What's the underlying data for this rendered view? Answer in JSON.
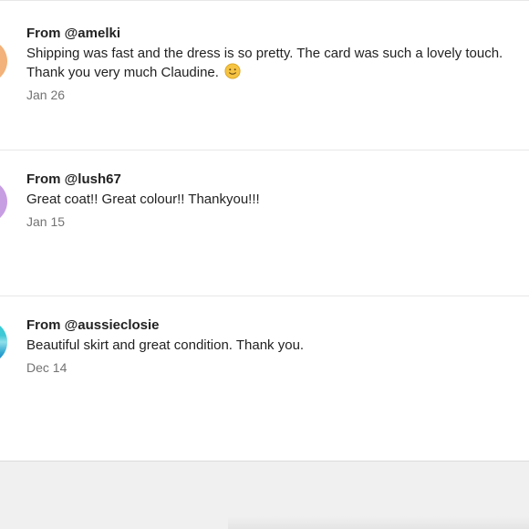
{
  "reviews": [
    {
      "from": "From @amelki",
      "message_line1": "Shipping was fast and the dress is so pretty. The card was such a lovely touch.",
      "message_line2": "Thank you very much Claudine.",
      "emoji_icon": "smiley-face-icon",
      "date": "Jan 26",
      "avatar_color": "#f2b27a"
    },
    {
      "from": "From @lush67",
      "message_line1": "Great coat!! Great colour!! Thankyou!!!",
      "date": "Jan 15",
      "avatar_color": "#c89ee2"
    },
    {
      "from": "From @aussieclosie",
      "message_line1": "Beautiful skirt and great condition. Thank you.",
      "date": "Dec 14",
      "avatar_color": "#2fd2d8"
    }
  ]
}
